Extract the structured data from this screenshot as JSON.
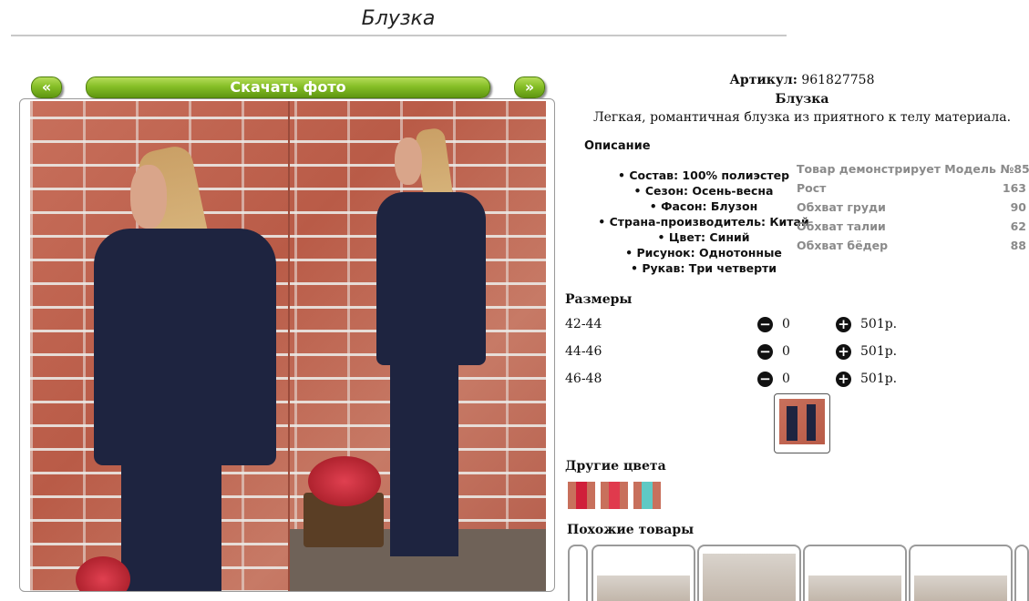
{
  "page": {
    "title": "Блузка"
  },
  "gallery": {
    "prev_label": "«",
    "download_label": "Скачать фото",
    "next_label": "»"
  },
  "product": {
    "article_label": "Артикул:",
    "article_value": "961827758",
    "name": "Блузка",
    "description": "Легкая, романтичная блузка из приятного к телу материала.",
    "description_heading": "Описание",
    "specs": [
      "Состав: 100% полиэстер",
      "Сезон: Осень-весна",
      "Фасон: Блузон",
      "Страна-производитель: Китай",
      "Цвет: Синий",
      "Рисунок: Однотонные",
      "Рукав: Три четверти"
    ]
  },
  "model": {
    "heading": "Товар демонстрирует Модель №85",
    "rows": [
      {
        "label": "Рост",
        "value": "163"
      },
      {
        "label": "Обхват груди",
        "value": "90"
      },
      {
        "label": "Обхват талии",
        "value": "62"
      },
      {
        "label": "Обхват бёдер",
        "value": "88"
      }
    ]
  },
  "sizes": {
    "heading": "Размеры",
    "rows": [
      {
        "size": "42-44",
        "qty": "0",
        "price": "501р."
      },
      {
        "size": "44-46",
        "qty": "0",
        "price": "501р."
      },
      {
        "size": "46-48",
        "qty": "0",
        "price": "501р."
      }
    ],
    "minus_icon": "−",
    "plus_icon": "+"
  },
  "other_colors": {
    "heading": "Другие цвета"
  },
  "similar": {
    "heading": "Похожие товары"
  },
  "colors": {
    "button_green": "#86bf27",
    "text": "#111111",
    "muted": "#8a8a8a"
  }
}
